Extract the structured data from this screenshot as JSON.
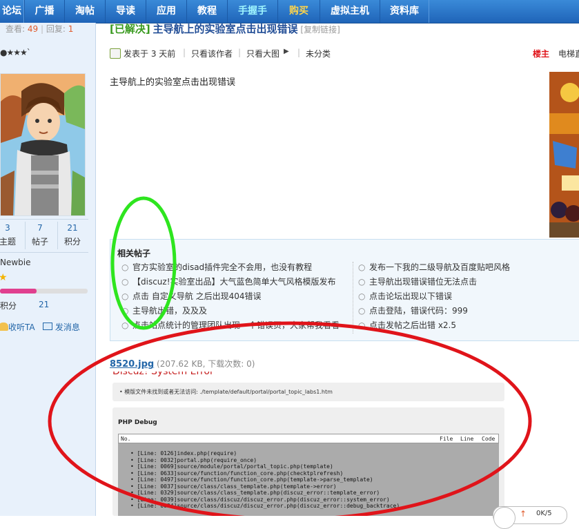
{
  "nav": {
    "items": [
      "论坛",
      "广播",
      "淘帖",
      "导读",
      "应用",
      "教程",
      "手握手",
      "购买",
      "虚拟主机",
      "资料库"
    ],
    "special_colors": {
      "手握手": "#9ff6ff",
      "购买": "#ffd54a"
    }
  },
  "sidebar": {
    "views_label": "查看:",
    "views_value": "49",
    "sep": "|",
    "replies_label": "回复:",
    "replies_value": "1",
    "stars": "●★★★`",
    "stats": [
      {
        "value": "3",
        "label": "主题"
      },
      {
        "value": "7",
        "label": "帖子"
      },
      {
        "value": "21",
        "label": "积分"
      }
    ],
    "rank": "Newbie",
    "rank_star": "★",
    "progress": 0.42,
    "credit_label": "积分",
    "credit_value": "21",
    "actions": [
      {
        "icon": "people-icon",
        "label": "收听TA"
      },
      {
        "icon": "mail-icon",
        "label": "发消息"
      }
    ]
  },
  "post": {
    "tag": "[已解决]",
    "title": "主导航上的实验室点击出现错误",
    "copy_link": "[复制链接]",
    "meta": {
      "posted": "发表于 3 天前",
      "only_author": "只看该作者",
      "big_image": "只看大图",
      "category": "未分类",
      "floor": "楼主",
      "elevator": "电梯直"
    },
    "body": "主导航上的实验室点击出现错误"
  },
  "related": {
    "heading": "相关帖子",
    "left": [
      "官方实验室的disad插件完全不会用，也没有教程",
      "【discuz!实验室出品】大气蓝色简单大气风格模版发布",
      "点击 自定义导航 之后出现404错误",
      "主导航出错，及及及",
      "点击站点统计的管理团队出现一个错误页，大家帮我看看"
    ],
    "right": [
      "发布一下我的二级导航及百度贴吧风格",
      "主导航出现错误错位无法点击",
      "点击论坛出现以下错误",
      "点击登陆，错误代码：999",
      "点击发帖之后出错 x2.5"
    ]
  },
  "attachment": {
    "name": "8520.jpg",
    "info": "(207.62 KB, 下载次数: 0)"
  },
  "screenshot": {
    "heading": "Discuz! System Error",
    "message": "模版文件未找到或者无法访问: ./template/default/portal/portal_topic_labs1.htm",
    "debug_title": "PHP Debug",
    "columns": [
      "No.",
      "File",
      "Line",
      "Code"
    ],
    "lines": [
      "[Line: 0126]index.php(require)",
      "[Line: 0032]portal.php(require_once)",
      "[Line: 0069]source/module/portal/portal_topic.php(template)",
      "[Line: 0633]source/function/function_core.php(checktplrefresh)",
      "[Line: 0497]source/function/function_core.php(template->parse_template)",
      "[Line: 0037]source/class/class_template.php(template->error)",
      "[Line: 0329]source/class/class_template.php(discuz_error::template_error)",
      "[Line: 0039]source/class/discuz/discuz_error.php(discuz_error::system_error)",
      "[Line: 0024]source/class/discuz/discuz_error.php(discuz_error::debug_backtrace)"
    ]
  },
  "vote": {
    "text": "0K/5"
  },
  "colors": {
    "nav": "#2a73c6",
    "sidebar": "#e8f1fb",
    "green_ring": "#2ee51f",
    "red_ring": "#e0141a"
  }
}
